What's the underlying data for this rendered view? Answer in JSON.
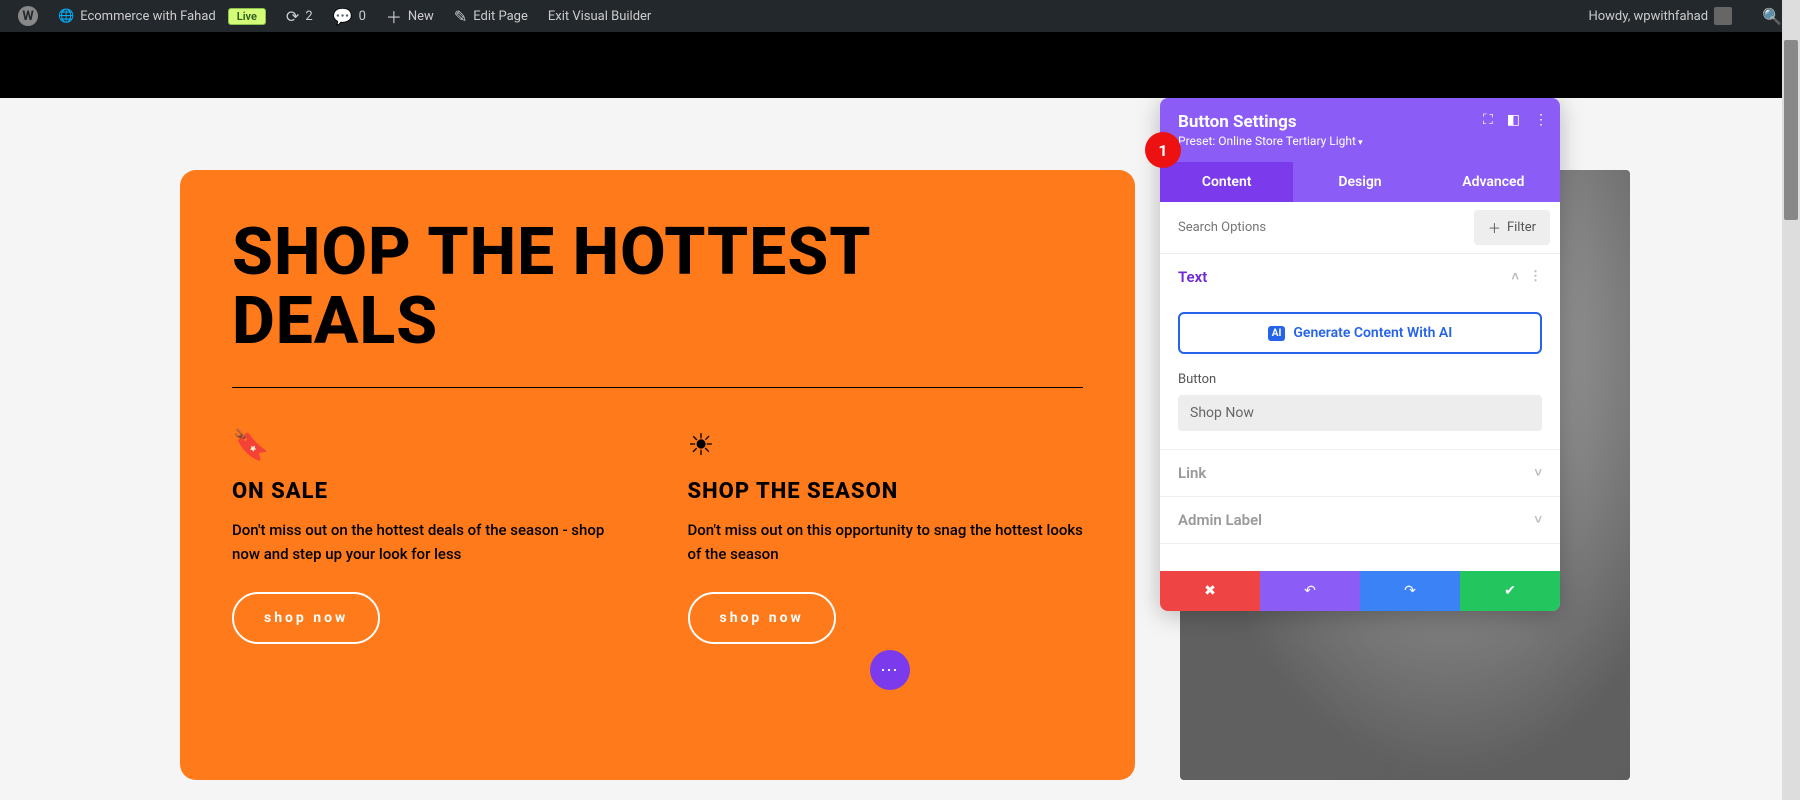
{
  "adminbar": {
    "site_name": "Ecommerce with Fahad",
    "live_label": "Live",
    "updates_count": "2",
    "comments_count": "0",
    "new_label": "New",
    "edit_page_label": "Edit Page",
    "exit_builder_label": "Exit Visual Builder",
    "howdy": "Howdy, wpwithfahad"
  },
  "hero": {
    "headline": "SHOP THE HOTTEST DEALS",
    "blocks": [
      {
        "icon": "bookmark-icon",
        "title": "ON SALE",
        "text": "Don't miss out on the hottest deals of the season - shop now and step up your look for less",
        "button": "shop now"
      },
      {
        "icon": "sun-icon",
        "title": "SHOP THE SEASON",
        "text": "Don't miss out on this opportunity to snag the hottest looks of the season",
        "button": "shop now"
      }
    ]
  },
  "panel": {
    "title": "Button Settings",
    "preset": "Preset: Online Store Tertiary Light",
    "badge": "1",
    "tabs": {
      "content": "Content",
      "design": "Design",
      "advanced": "Advanced"
    },
    "search_placeholder": "Search Options",
    "filter_label": "Filter",
    "sections": {
      "text": {
        "label": "Text",
        "ai_button": "Generate Content With AI",
        "button_field_label": "Button",
        "button_field_value": "Shop Now"
      },
      "link": {
        "label": "Link"
      },
      "admin_label": {
        "label": "Admin Label"
      }
    }
  }
}
